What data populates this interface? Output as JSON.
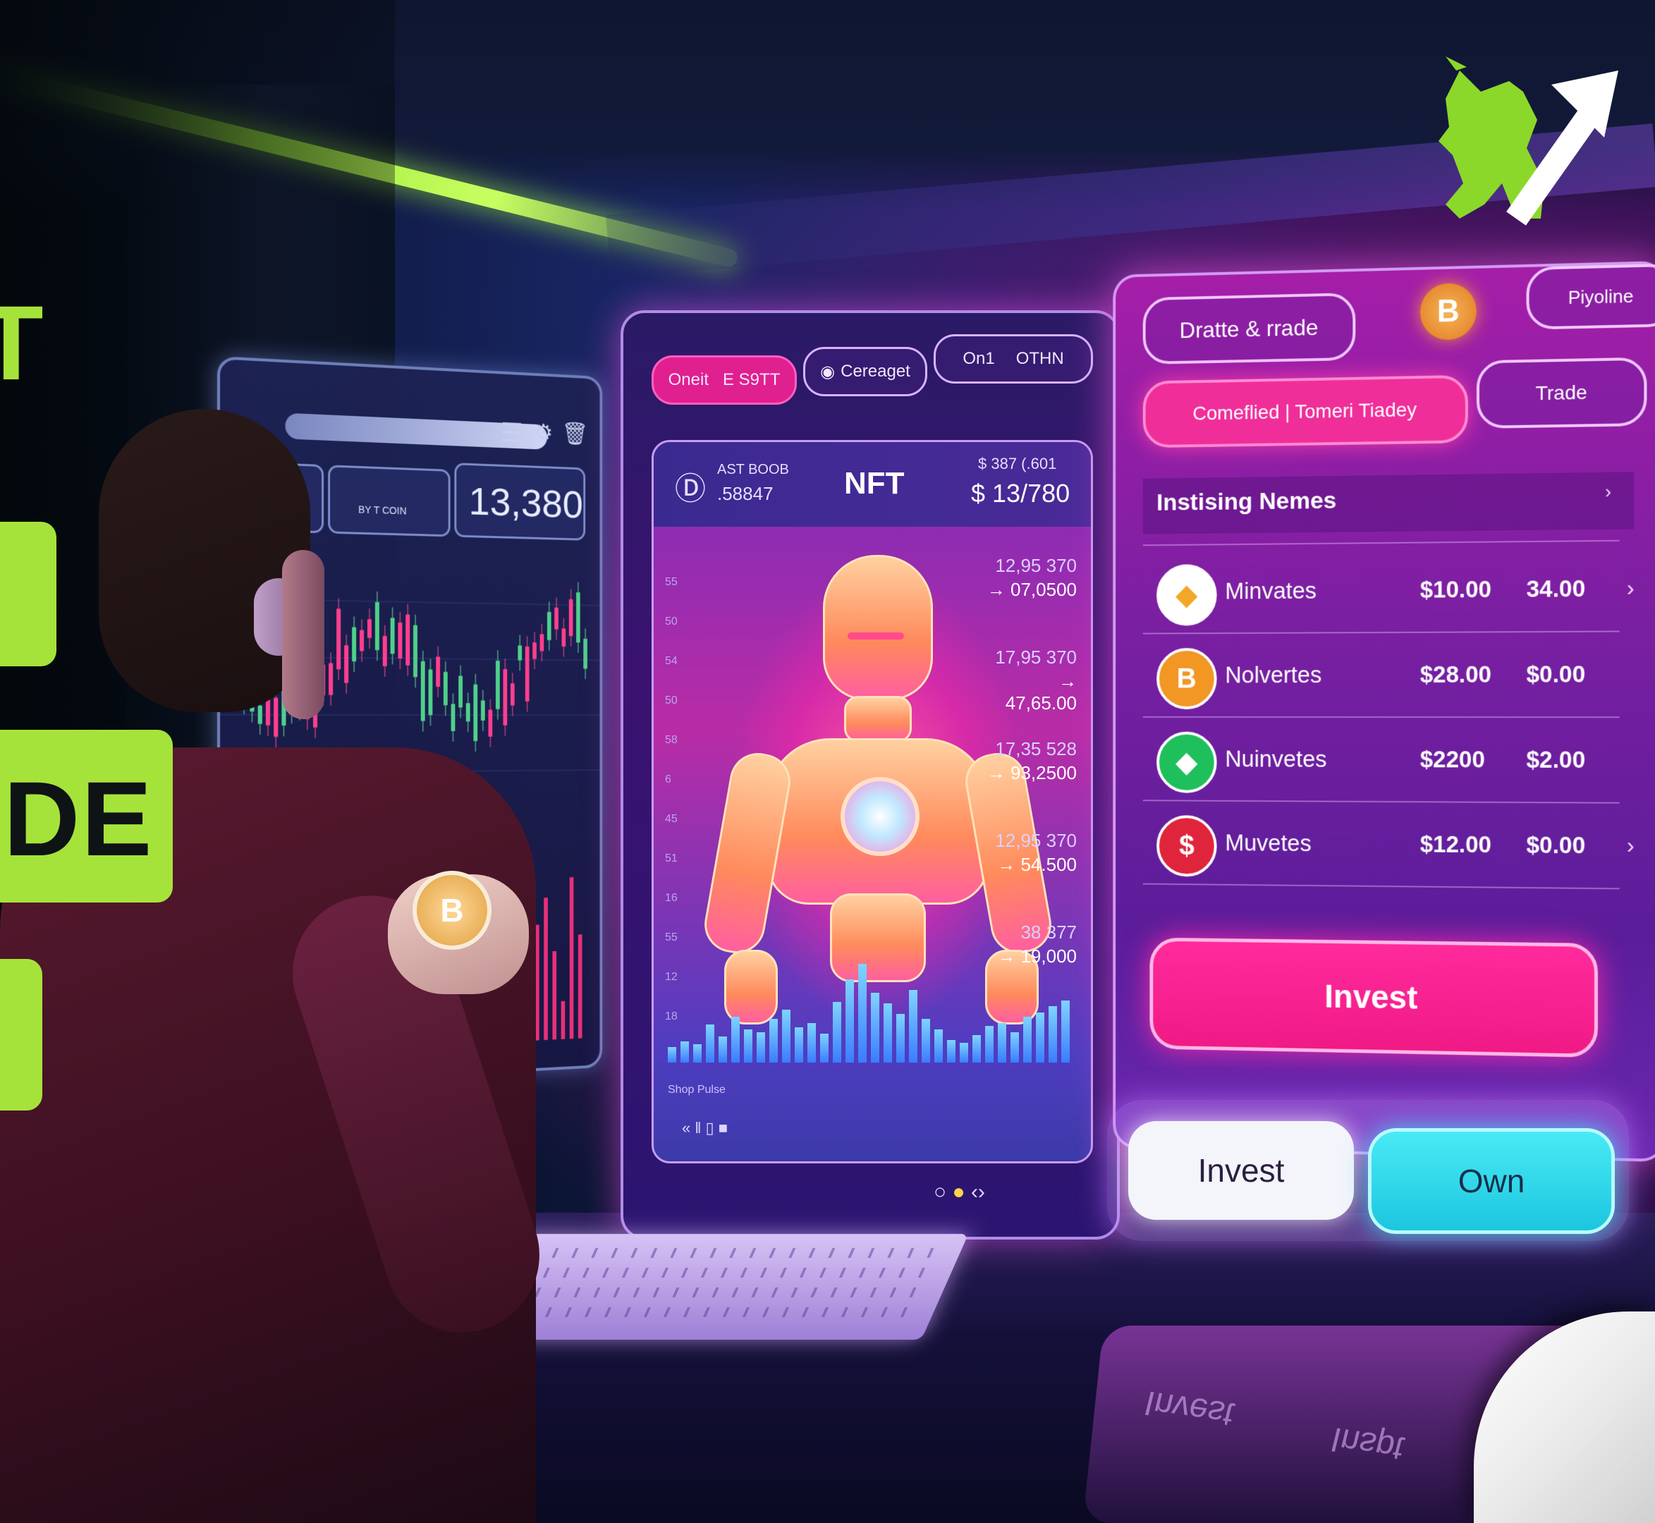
{
  "headline": {
    "line1": "T",
    "line3": "DE"
  },
  "left_monitor": {
    "stat_small": "BY T COIN",
    "stat_big": "13,380"
  },
  "middle_monitor": {
    "tabs": [
      "Oneit",
      "E S9TT",
      "Cereaget",
      "On1",
      "OTHN"
    ],
    "nft_title": "NFT",
    "nft_id_top": "AST BOOB",
    "nft_id_bottom": ".58847",
    "price_top": "$ 387 (.601",
    "price_main": "$ 13/780",
    "tickers": [
      {
        "top": "12,95 370",
        "bottom": "07,0500"
      },
      {
        "top": "17,95 370",
        "bottom": "47,65.00"
      },
      {
        "top": "17,35 528",
        "bottom": "93,2500"
      },
      {
        "top": "12,95 370",
        "bottom": "54.500"
      },
      {
        "top": "38 377",
        "bottom": "19,000"
      }
    ],
    "bar_heights": [
      20,
      28,
      24,
      50,
      34,
      60,
      44,
      40,
      58,
      70,
      46,
      52,
      38,
      80,
      110,
      130,
      92,
      78,
      64,
      96,
      58,
      44,
      30,
      26,
      36,
      48,
      52,
      40,
      60,
      66,
      74,
      82
    ],
    "y_ticks": [
      "55",
      "50",
      "54",
      "50",
      "58",
      "6",
      "45",
      "51",
      "16",
      "55",
      "12",
      "18"
    ],
    "footer_text": "Shop Pulse"
  },
  "right_panel": {
    "header_pill": "Dratte & rrade",
    "pipeline_pill": "Piyoline",
    "coin_badge": "B",
    "comeflied_pill": "Comeflied | Tomeri Tiadey",
    "trade_pill": "Trade",
    "section_title": "Instising Nemes",
    "assets": [
      {
        "icon": "eth",
        "symbol": "◆",
        "color": "#f2a726",
        "name": "Minvates",
        "price": "$10.00",
        "change": "34.00"
      },
      {
        "icon": "btc",
        "symbol": "B",
        "color": "#f29624",
        "name": "Nolvertes",
        "price": "$28.00",
        "change": "$0.00"
      },
      {
        "icon": "gem",
        "symbol": "◆",
        "color": "#1fbf5c",
        "name": "Nuinvetes",
        "price": "$2200",
        "change": "$2.00"
      },
      {
        "icon": "dollar",
        "symbol": "$",
        "color": "#e0243c",
        "name": "Muvetes",
        "price": "$12.00",
        "change": "$0.00"
      }
    ],
    "invest_button": "Invest",
    "invest_toggle": "Invest",
    "own_toggle": "Own"
  },
  "reflection": {
    "text1": "Invest",
    "text2": "Inspt"
  }
}
